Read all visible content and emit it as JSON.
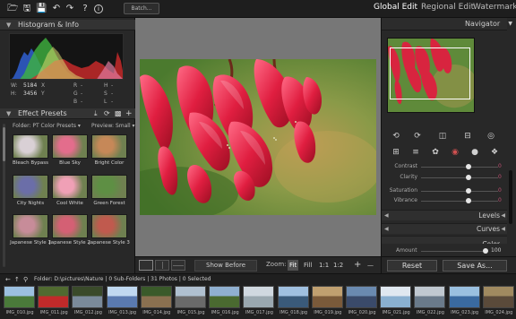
{
  "toolbar": {
    "batch_label": "Batch...",
    "icons": [
      "open-folder-icon",
      "save-icon",
      "save-as-icon",
      "undo-icon",
      "redo-icon",
      "help-icon",
      "info-icon"
    ]
  },
  "modes": {
    "global_edit": "Global Edit",
    "regional_edit": "Regional Edit",
    "watermark": "Watermark",
    "active": "Global Edit"
  },
  "histogram": {
    "title": "Histogram & Info",
    "w_label": "W:",
    "w_value": "5184",
    "w_unit": "X",
    "h_label": "H:",
    "h_value": "3456",
    "h_unit": "Y",
    "r_label": "R",
    "g_label": "G",
    "b_label": "B",
    "hh_label": "H",
    "s_label": "S",
    "l_label": "L",
    "dash": "-"
  },
  "presets": {
    "title": "Effect Presets",
    "folder_label": "Folder: PT Color Presets",
    "preview_label": "Preview: Small",
    "items": [
      "Bleach Bypass",
      "Blue Sky",
      "Bright Color",
      "City Nights",
      "Cool White",
      "Green Forest",
      "Japanese Style 1",
      "Japanese Style 2",
      "Japanese Style 3"
    ]
  },
  "center_bar": {
    "show_before": "Show Before",
    "zoom_label": "Zoom:",
    "zoom_fit": "Fit",
    "zoom_fill": "Fill",
    "zoom_1_1": "1:1",
    "zoom_1_2": "1:2",
    "zoom_plus": "+",
    "zoom_minus": "—"
  },
  "navigator": {
    "title": "Navigator"
  },
  "adjustments": {
    "contrast": "Contrast",
    "clarity": "Clarity",
    "saturation": "Saturation",
    "vibrance": "Vibrance",
    "contrast_level": 0.62,
    "clarity_level": 0.62,
    "saturation_level": 0.62,
    "vibrance_level": 0.62,
    "value": "0"
  },
  "accordions": {
    "levels": "Levels",
    "curves": "Curves",
    "color": "Color"
  },
  "amount": {
    "label": "Amount",
    "value": "100",
    "level": 1.0
  },
  "right_footer": {
    "reset": "Reset",
    "save_as": "Save As..."
  },
  "filmstrip_bar": {
    "text": "Folder: D:\\pictures\\Nature  |  0 Sub-Folders  |  31 Photos  |  0 Selected"
  },
  "filmstrip": [
    "IMG_010.jpg",
    "IMG_011.jpg",
    "IMG_012.jpg",
    "IMG_013.jpg",
    "IMG_014.jpg",
    "IMG_015.jpg",
    "IMG_016.jpg",
    "IMG_017.jpg",
    "IMG_018.jpg",
    "IMG_019.jpg",
    "IMG_020.jpg",
    "IMG_021.jpg",
    "IMG_022.jpg",
    "IMG_023.jpg",
    "IMG_024.jpg"
  ],
  "colors": {
    "accent_value": "#bb4d6f",
    "flower_red": "#d8243f",
    "background_green": "#5f8a3a"
  }
}
